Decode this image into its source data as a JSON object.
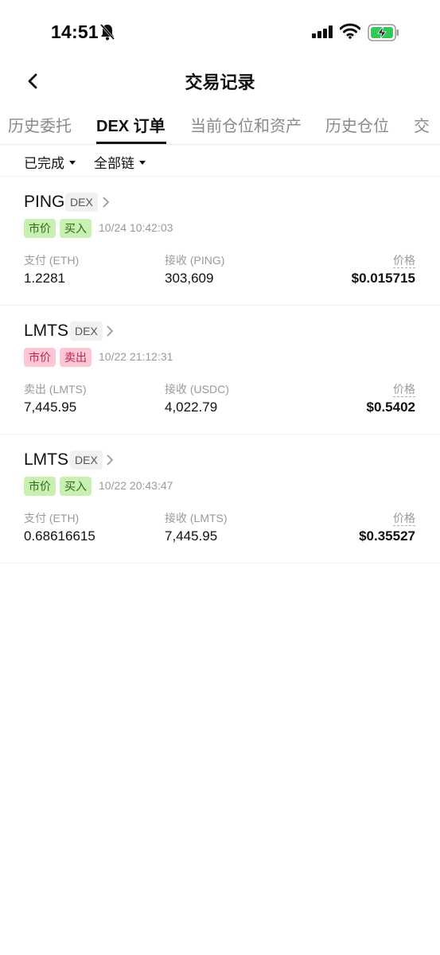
{
  "status_bar": {
    "time": "14:51"
  },
  "header": {
    "title": "交易记录"
  },
  "tabs": [
    {
      "label": "历史委托"
    },
    {
      "label": "DEX 订单"
    },
    {
      "label": "当前仓位和资产"
    },
    {
      "label": "历史仓位"
    },
    {
      "label": "交"
    }
  ],
  "filters": {
    "status": "已完成",
    "chain": "全部链"
  },
  "orders": [
    {
      "token": "PING",
      "venue": "DEX",
      "tag_type": "市价",
      "tag_side": "买入",
      "side": "buy",
      "time": "10/24 10:42:03",
      "pay_label": "支付 (ETH)",
      "pay_value": "1.2281",
      "receive_label": "接收 (PING)",
      "receive_value": "303,609",
      "price_label": "价格",
      "price_value": "$0.015715"
    },
    {
      "token": "LMTS",
      "venue": "DEX",
      "tag_type": "市价",
      "tag_side": "卖出",
      "side": "sell",
      "time": "10/22 21:12:31",
      "pay_label": "卖出 (LMTS)",
      "pay_value": "7,445.95",
      "receive_label": "接收 (USDC)",
      "receive_value": "4,022.79",
      "price_label": "价格",
      "price_value": "$0.5402"
    },
    {
      "token": "LMTS",
      "venue": "DEX",
      "tag_type": "市价",
      "tag_side": "买入",
      "side": "buy",
      "time": "10/22 20:43:47",
      "pay_label": "支付 (ETH)",
      "pay_value": "0.68616615",
      "receive_label": "接收 (LMTS)",
      "receive_value": "7,445.95",
      "price_label": "价格",
      "price_value": "$0.35527"
    }
  ],
  "colors": {
    "buy_tag_bg": "#c9efb3",
    "buy_tag_text": "#2b6b14",
    "sell_tag_bg": "#ffc7d6",
    "sell_tag_text": "#b0284d",
    "battery_fill": "#34c759"
  }
}
